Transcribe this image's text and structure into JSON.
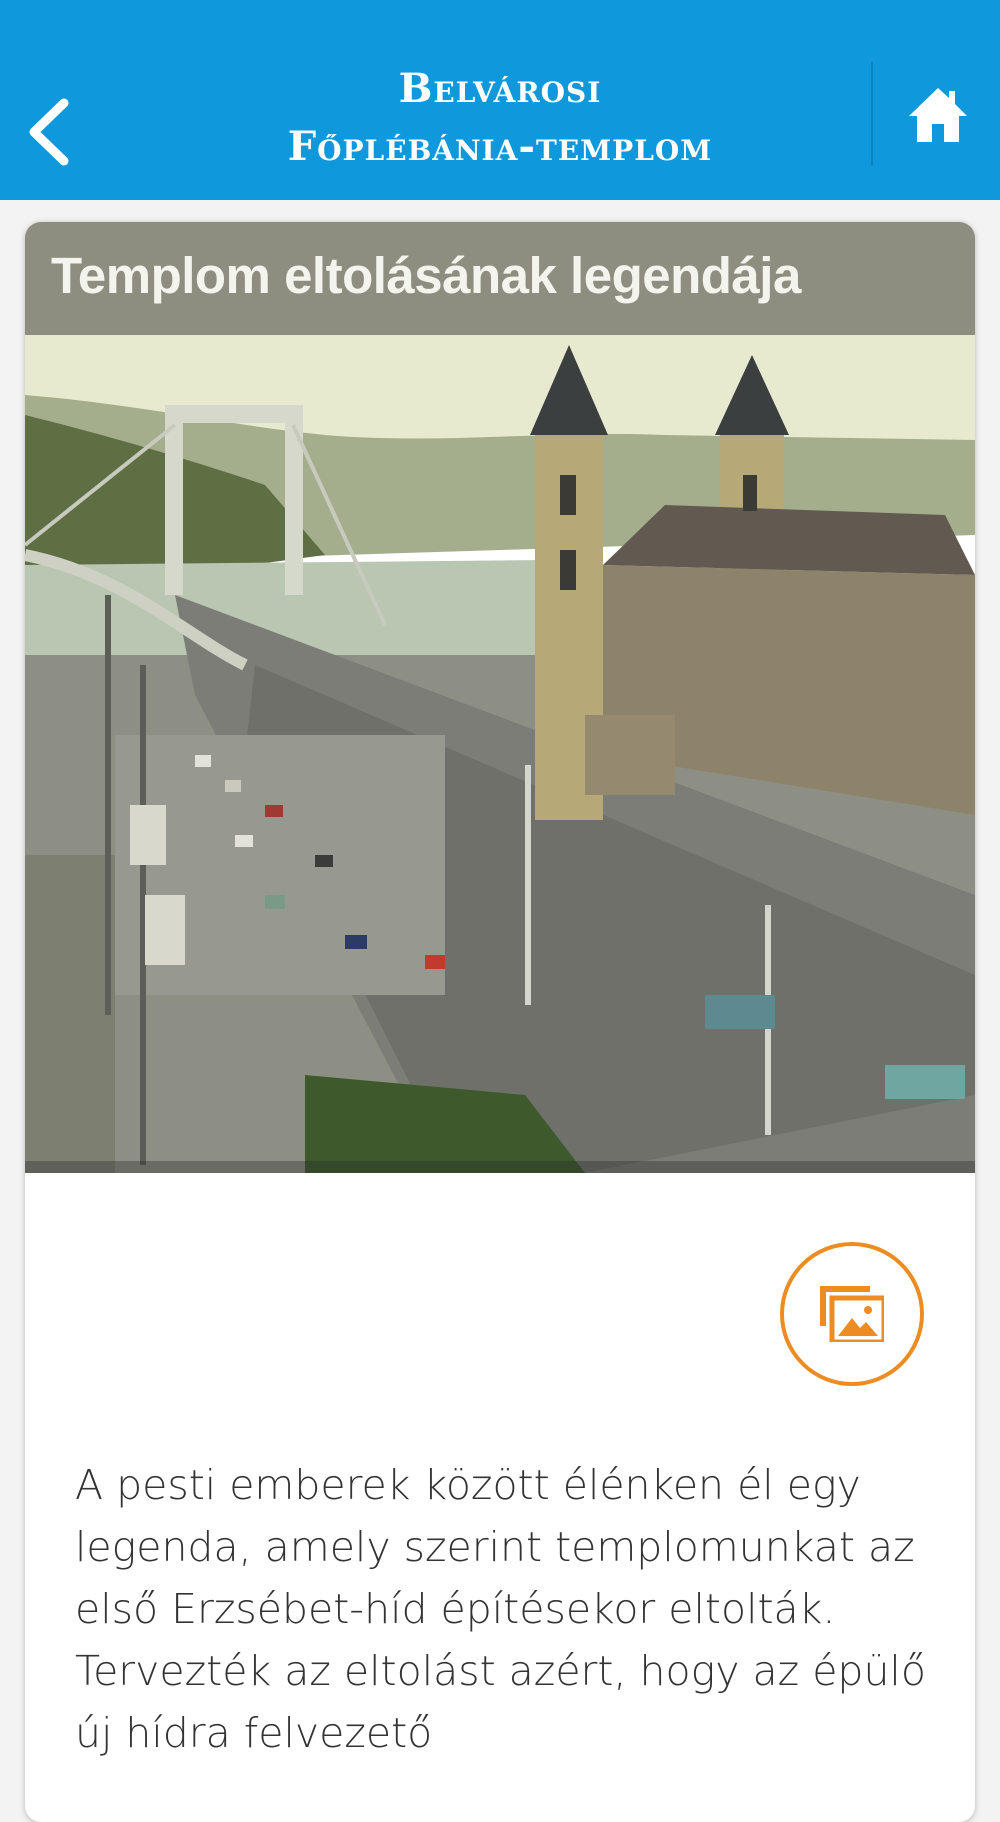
{
  "header": {
    "title_line1": "Belvárosi",
    "title_line2": "Főplébánia-templom",
    "background_color": "#0f99dc",
    "back_icon": "chevron-left-icon",
    "home_icon": "home-icon"
  },
  "card": {
    "title": "Templom eltolásának legendája",
    "photo_controls": {
      "prev_icon": "chevron-left-icon",
      "list_icon": "list-icon",
      "next_icon": "chevron-right-icon"
    },
    "gallery_icon": "image-gallery-icon",
    "accent_color": "#ec8c22",
    "body_text": "A pesti emberek között élénken él egy legenda, amely szerint templomunkat az első Erzsébet-híd építésekor eltolták. Tervezték az eltolást azért, hogy az épülő új hídra felvezető"
  }
}
